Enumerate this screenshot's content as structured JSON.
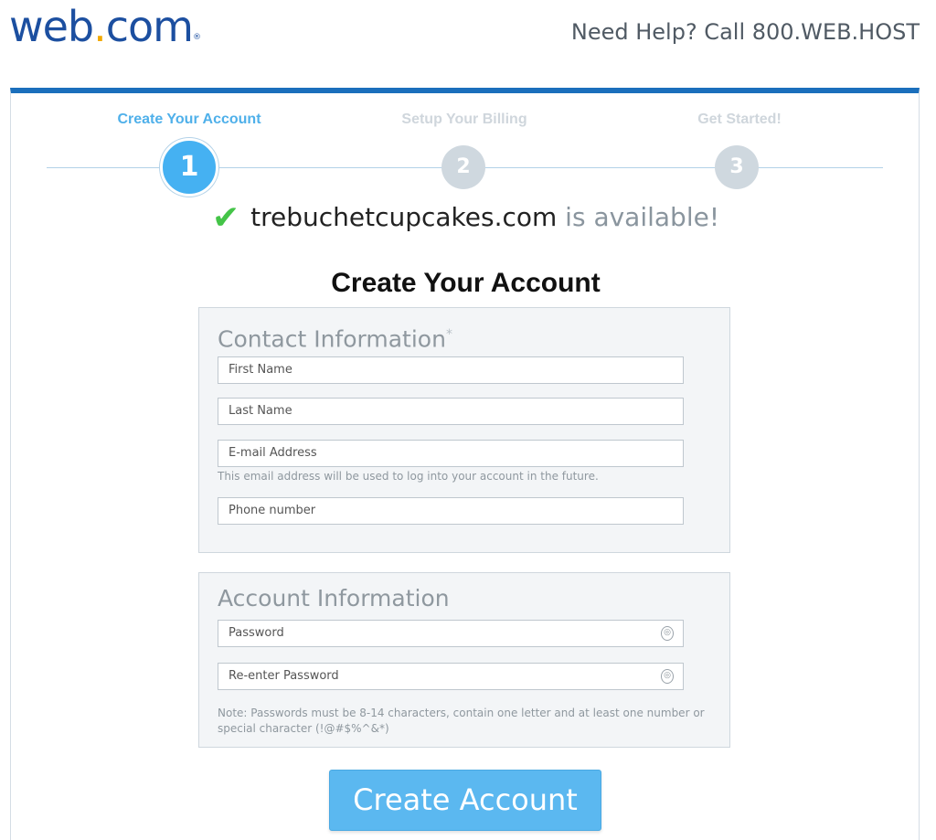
{
  "header": {
    "logo_web": "web",
    "logo_dot": ".",
    "logo_com": "com",
    "logo_reg": "®",
    "help_text": "Need Help? Call 800.WEB.HOST"
  },
  "steps": [
    {
      "label": "Create Your Account",
      "number": "1",
      "state": "active"
    },
    {
      "label": "Setup Your Billing",
      "number": "2",
      "state": "inactive"
    },
    {
      "label": "Get Started!",
      "number": "3",
      "state": "inactive"
    }
  ],
  "availability": {
    "domain": "trebuchetcupcakes.com",
    "status": " is available!"
  },
  "page_title": "Create Your Account",
  "contact": {
    "heading": "Contact Information",
    "required_mark": "*",
    "first_name_placeholder": "First Name",
    "last_name_placeholder": "Last Name",
    "email_placeholder": "E-mail Address",
    "email_hint": "This email address will be used to log into your account in the future.",
    "phone_placeholder": "Phone number"
  },
  "account": {
    "heading": "Account Information",
    "password_placeholder": "Password",
    "reenter_placeholder": "Re-enter Password",
    "note_line1": "Note: Passwords must be 8-14 characters, contain one letter and at least one number or",
    "note_line2": "special character (!@#$%^&*)"
  },
  "cta_label": "Create Account",
  "colors": {
    "brand_blue": "#1c4fa0",
    "accent_blue": "#45b1f2",
    "success_green": "#44c448",
    "top_bar": "#1b6fbc"
  },
  "icons": {
    "check": "check-icon",
    "lock": "lock-icon"
  }
}
